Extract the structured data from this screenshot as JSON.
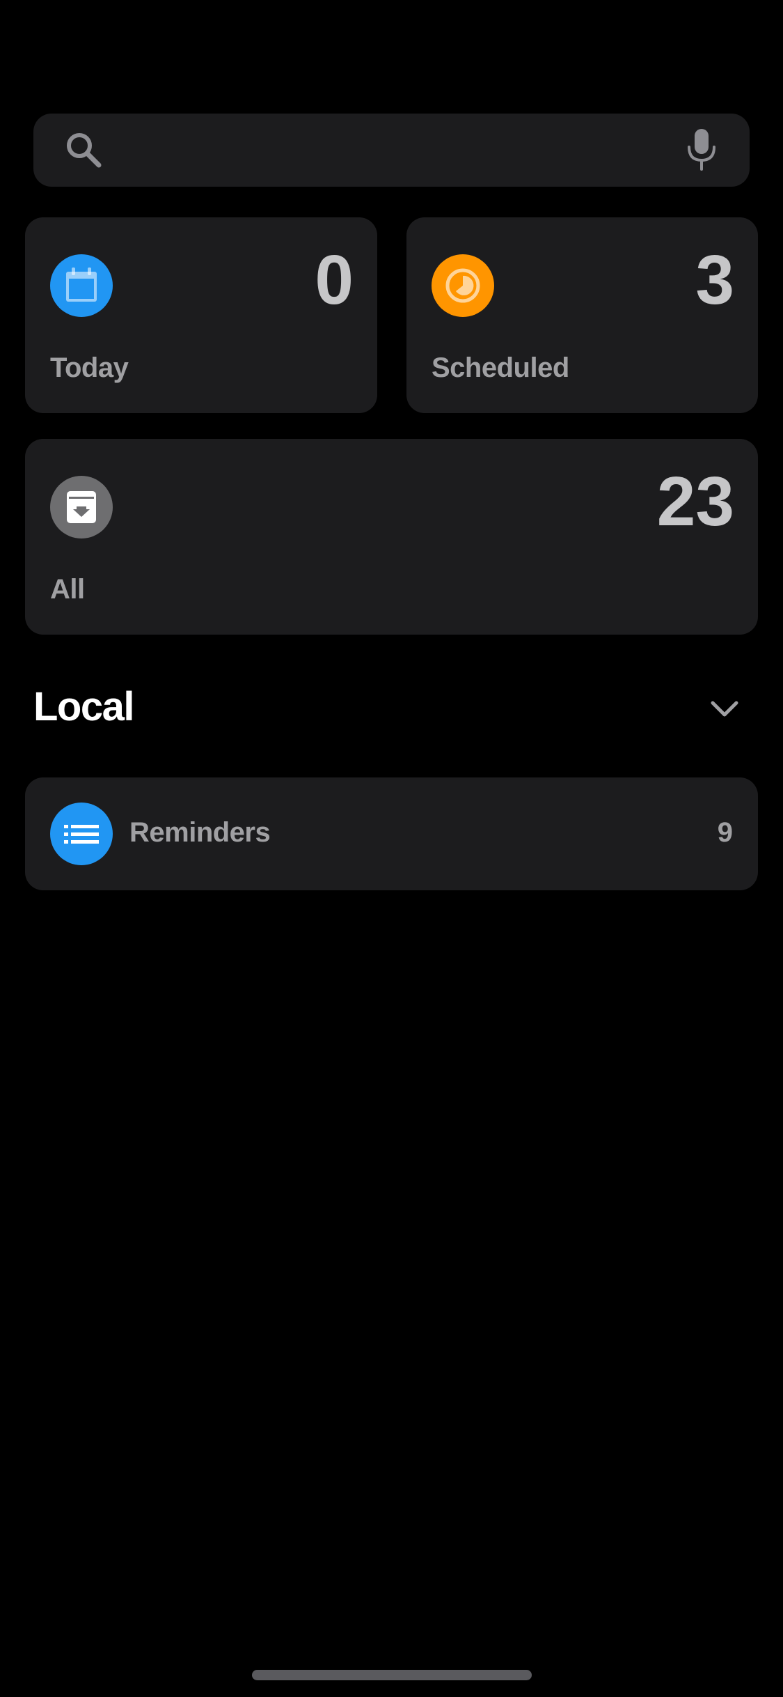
{
  "search": {
    "value": "",
    "placeholder": "",
    "icon": "search-icon",
    "mic_icon": "microphone-icon"
  },
  "smart_lists": [
    {
      "label": "Today",
      "count": "0",
      "icon": "calendar-icon",
      "color": "#2196f3"
    },
    {
      "label": "Scheduled",
      "count": "3",
      "icon": "clock-icon",
      "color": "#ff9500"
    },
    {
      "label": "All",
      "count": "23",
      "icon": "archive-tray-icon",
      "color": "#6e6e70"
    }
  ],
  "section": {
    "title": "Local",
    "toggle_icon": "chevron-down-icon"
  },
  "lists": [
    {
      "label": "Reminders",
      "count": "9",
      "icon": "list-bullet-icon",
      "color": "#2196f3"
    }
  ],
  "colors": {
    "background": "#000000",
    "card": "#1c1c1e",
    "count_text": "#c6c6c8",
    "label_text": "#a0a0a3"
  }
}
